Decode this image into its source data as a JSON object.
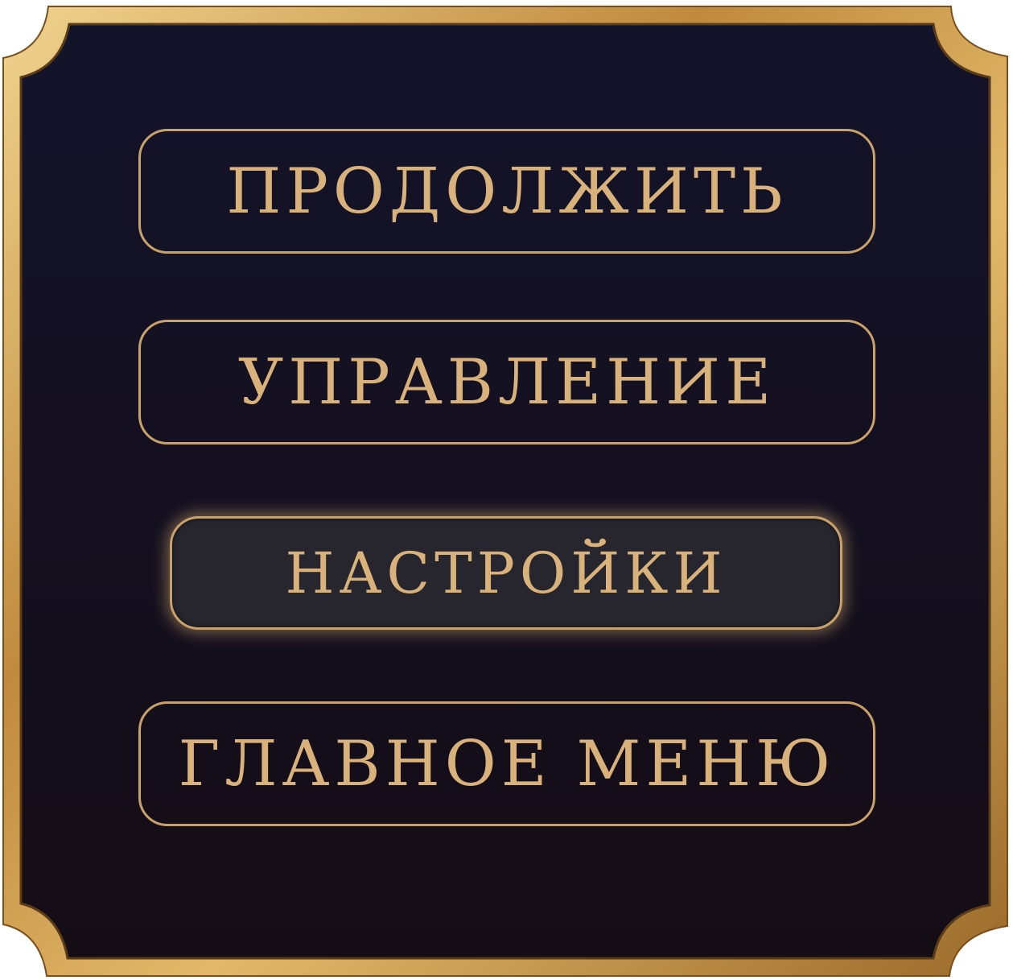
{
  "pause_menu": {
    "buttons": [
      {
        "label": "Продолжить"
      },
      {
        "label": "Управление"
      },
      {
        "label": "настройки"
      },
      {
        "label": "Главное меню"
      }
    ],
    "selected_index": 2
  },
  "colors": {
    "gold": "#c9a26a",
    "text": "#d8b27a",
    "panel_top": "#13132a",
    "panel_bottom": "#150d16",
    "selected_fill": "#27252d"
  }
}
